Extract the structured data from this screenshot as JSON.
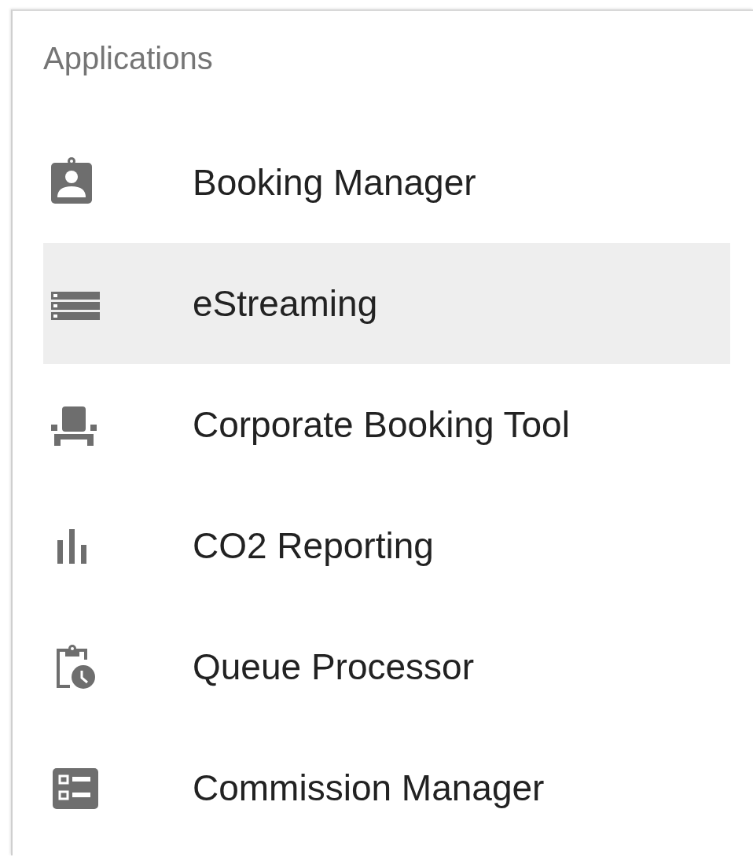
{
  "panel": {
    "title": "Applications"
  },
  "items": [
    {
      "label": "Booking Manager",
      "selected": false
    },
    {
      "label": "eStreaming",
      "selected": true
    },
    {
      "label": "Corporate Booking Tool",
      "selected": false
    },
    {
      "label": "CO2 Reporting",
      "selected": false
    },
    {
      "label": "Queue Processor",
      "selected": false
    },
    {
      "label": "Commission Manager",
      "selected": false
    }
  ]
}
